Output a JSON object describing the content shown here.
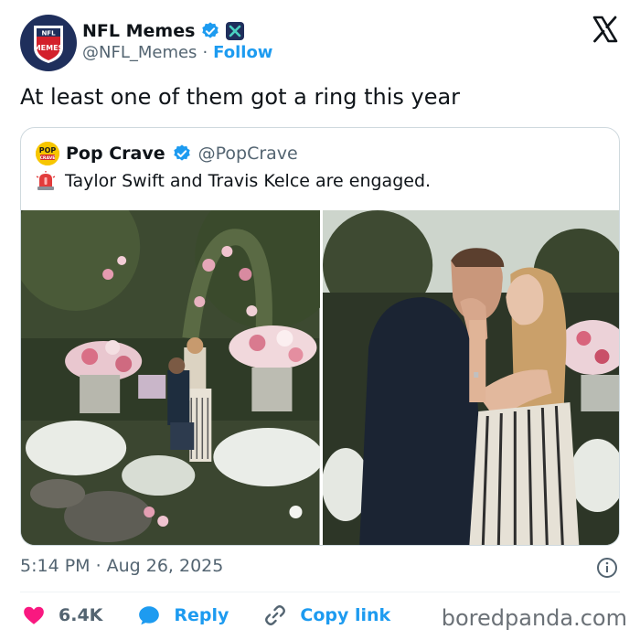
{
  "author": {
    "name": "NFL Memes",
    "handle": "@NFL_Memes",
    "separator": "·",
    "follow_label": "Follow",
    "avatar_text_top": "NFL",
    "avatar_text_main": "MEMES"
  },
  "tweet": {
    "text": "At least one of them got a ring this year",
    "time": "5:14 PM",
    "separator": "·",
    "date": "Aug 26, 2025"
  },
  "quote": {
    "name": "Pop Crave",
    "handle": "@PopCrave",
    "logo_text": "POP CRAVE",
    "text": "Taylor Swift and Travis Kelce are engaged."
  },
  "actions": {
    "likes": "6.4K",
    "reply_label": "Reply",
    "copy_link_label": "Copy link"
  },
  "watermark": "boredpanda.com",
  "colors": {
    "accent": "#1d9bf0",
    "like": "#f91880",
    "text": "#0f1419",
    "muted": "#536471",
    "border": "#cfd9de"
  }
}
